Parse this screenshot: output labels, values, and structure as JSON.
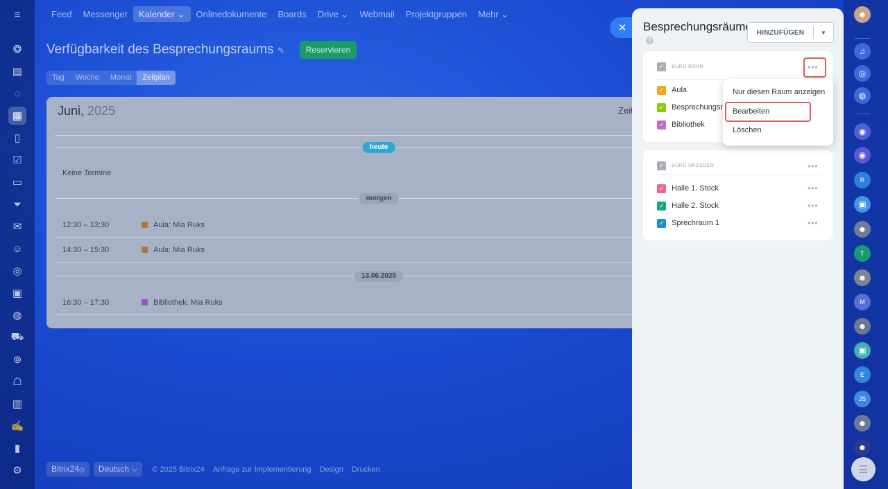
{
  "top_nav": {
    "items": [
      {
        "label": "Feed",
        "active": false
      },
      {
        "label": "Messenger",
        "active": false
      },
      {
        "label": "Kalender ⌄",
        "active": true
      },
      {
        "label": "Onlinedokumente",
        "active": false
      },
      {
        "label": "Boards",
        "active": false
      },
      {
        "label": "Drive ⌄",
        "active": false
      },
      {
        "label": "Webmail",
        "active": false
      },
      {
        "label": "Projektgruppen",
        "active": false
      },
      {
        "label": "Mehr ⌄",
        "active": false
      }
    ]
  },
  "left_rail": {
    "icons": [
      "menu-icon",
      "activity-icon",
      "feed-icon",
      "chat-icon",
      "calendar-icon",
      "documents-icon",
      "tasks-icon",
      "crm-icon",
      "filter-icon",
      "mail-icon",
      "users-icon",
      "sites-icon",
      "board-icon",
      "goals-icon",
      "cart-icon",
      "automation-icon",
      "robot-icon",
      "store-icon",
      "sign-icon",
      "analytics-icon",
      "settings-icon"
    ],
    "active": "calendar-icon"
  },
  "page": {
    "title": "Verfügbarkeit des Besprechungsraums",
    "reserve_label": "Reservieren",
    "view_tabs": [
      {
        "label": "Tag",
        "active": false
      },
      {
        "label": "Woche",
        "active": false
      },
      {
        "label": "Monat",
        "active": false
      },
      {
        "label": "Zeitplan",
        "active": true
      }
    ]
  },
  "calendar": {
    "month": "Juni,",
    "year": "2025",
    "zeit_label": "Zeit",
    "today_label": "heute",
    "no_events_label": "Keine Termine",
    "tomorrow_label": "morgen",
    "date_label": "13.06.2025",
    "events": [
      {
        "time": "12:30 – 13:30",
        "title": "Aula: Mia Ruks",
        "color": "#a9783a"
      },
      {
        "time": "14:30 – 15:30",
        "title": "Aula: Mia Ruks",
        "color": "#a9783a"
      },
      {
        "time": "16:30 – 17:30",
        "title": "Bibliothek: Mia Ruks",
        "color": "#9456c2"
      }
    ]
  },
  "footer": {
    "brand": "Bitrix24",
    "language": "Deutsch",
    "copyright": "© 2025 Bitrix24",
    "links": [
      "Anfrage zur Implementierung",
      "Design",
      "Drucken"
    ]
  },
  "panel": {
    "title": "Besprechungsräume",
    "help_icon": "?",
    "add_label": "HINZUFÜGEN",
    "sections": [
      {
        "title": "BÜRO BONN",
        "rooms": [
          {
            "name": "Aula",
            "color": "#f2a31b"
          },
          {
            "name": "Besprechungsraum",
            "color": "#8fc90e"
          },
          {
            "name": "Bibliothek",
            "color": "#c06ccf"
          }
        ]
      },
      {
        "title": "BÜRO DRESDEN",
        "rooms": [
          {
            "name": "Halle 1. Stock",
            "color": "#e8688a"
          },
          {
            "name": "Halle 2. Stock",
            "color": "#17a87a"
          },
          {
            "name": "Sprechraum 1",
            "color": "#1c8fd6"
          }
        ]
      }
    ]
  },
  "context_menu": {
    "items": [
      "Nur diesen Raum anzeigen",
      "Bearbeiten",
      "Löschen"
    ],
    "highlighted": "Bearbeiten"
  },
  "right_rail": {
    "items": [
      {
        "label": "",
        "color": "#c9a48a",
        "icon": "avatar"
      },
      {
        "label": "",
        "color": "#3d6ad8",
        "icon": "bell-icon"
      },
      {
        "label": "",
        "color": "#3d6ad8",
        "icon": "target-icon"
      },
      {
        "label": "",
        "color": "#3d6ad8",
        "icon": "search-chat-icon"
      },
      {
        "label": "",
        "color": "#4f5fd9",
        "icon": "copilot-icon"
      },
      {
        "label": "",
        "color": "#5b57d6",
        "icon": "copilot-icon"
      },
      {
        "label": "R",
        "color": "#2f7fd8",
        "icon": "letter-avatar"
      },
      {
        "label": "",
        "color": "#3c97e6",
        "icon": "chat-avatar"
      },
      {
        "label": "",
        "color": "#6f7d9a",
        "icon": "photo-avatar"
      },
      {
        "label": "T",
        "color": "#1a9a72",
        "icon": "letter-avatar"
      },
      {
        "label": "",
        "color": "#7d8494",
        "icon": "photo-avatar"
      },
      {
        "label": "M",
        "color": "#5a6fd6",
        "icon": "letter-avatar"
      },
      {
        "label": "",
        "color": "#6c7890",
        "icon": "photo-avatar"
      },
      {
        "label": "",
        "color": "#3fb0b6",
        "icon": "chat-avatar"
      },
      {
        "label": "E",
        "color": "#2f86da",
        "icon": "letter-avatar"
      },
      {
        "label": "JS",
        "color": "#3a8be0",
        "icon": "letter-avatar"
      },
      {
        "label": "",
        "color": "#6b7a96",
        "icon": "photo-avatar"
      },
      {
        "label": "",
        "color": "#2b3a8a",
        "icon": "photo-avatar"
      }
    ]
  }
}
